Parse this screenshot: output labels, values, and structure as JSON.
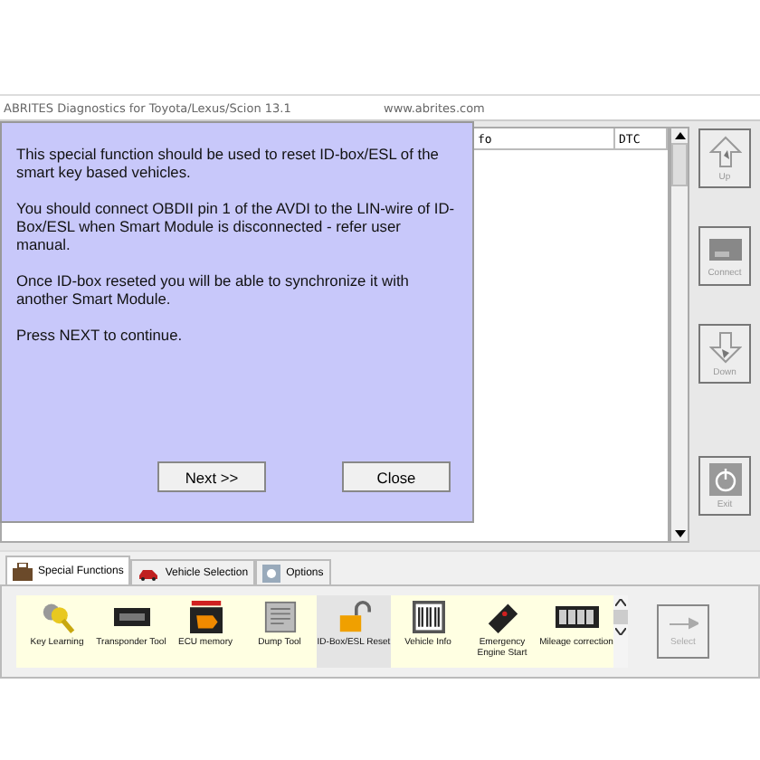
{
  "window": {
    "title": "ABRITES Diagnostics for Toyota/Lexus/Scion 13.1",
    "url": "www.abrites.com"
  },
  "dialog": {
    "paragraphs": [
      "This special function should be used to reset ID-box/ESL of the smart key based vehicles.",
      "You should connect OBDII pin 1 of the AVDI to the LIN-wire of ID-Box/ESL when Smart Module is disconnected - refer user manual.",
      "Once ID-box reseted you will be able to synchronize it with another Smart Module.",
      "Press NEXT to continue."
    ],
    "buttons": [
      "Next >>",
      "Close"
    ]
  },
  "table": {
    "columns": [
      "fo",
      "DTC"
    ]
  },
  "side_buttons": [
    {
      "label": "Up",
      "kind": "up"
    },
    {
      "label": "Connect",
      "kind": "connect"
    },
    {
      "label": "Down",
      "kind": "down"
    },
    {
      "label": "Exit",
      "kind": "exit"
    }
  ],
  "tabs": [
    {
      "label": "Special Functions",
      "selected": true,
      "kind": "functions"
    },
    {
      "label": "Vehicle Selection",
      "selected": false,
      "kind": "car"
    },
    {
      "label": "Options",
      "selected": false,
      "kind": "options"
    }
  ],
  "functions": [
    {
      "label": "Key Learning",
      "kind": "key",
      "selected": false
    },
    {
      "label": "Transponder Tool",
      "kind": "chip",
      "selected": false
    },
    {
      "label": "ECU memory",
      "kind": "ecu",
      "selected": false
    },
    {
      "label": "Dump Tool",
      "kind": "dump",
      "selected": false
    },
    {
      "label": "ID-Box/ESL Reset",
      "kind": "lock",
      "selected": true
    },
    {
      "label": "Vehicle Info",
      "kind": "barcode",
      "selected": false
    },
    {
      "label": "Emergency Engine Start",
      "kind": "fob",
      "selected": false
    },
    {
      "label": "Mileage correction",
      "kind": "odo",
      "selected": false
    }
  ],
  "select_button": "Select"
}
